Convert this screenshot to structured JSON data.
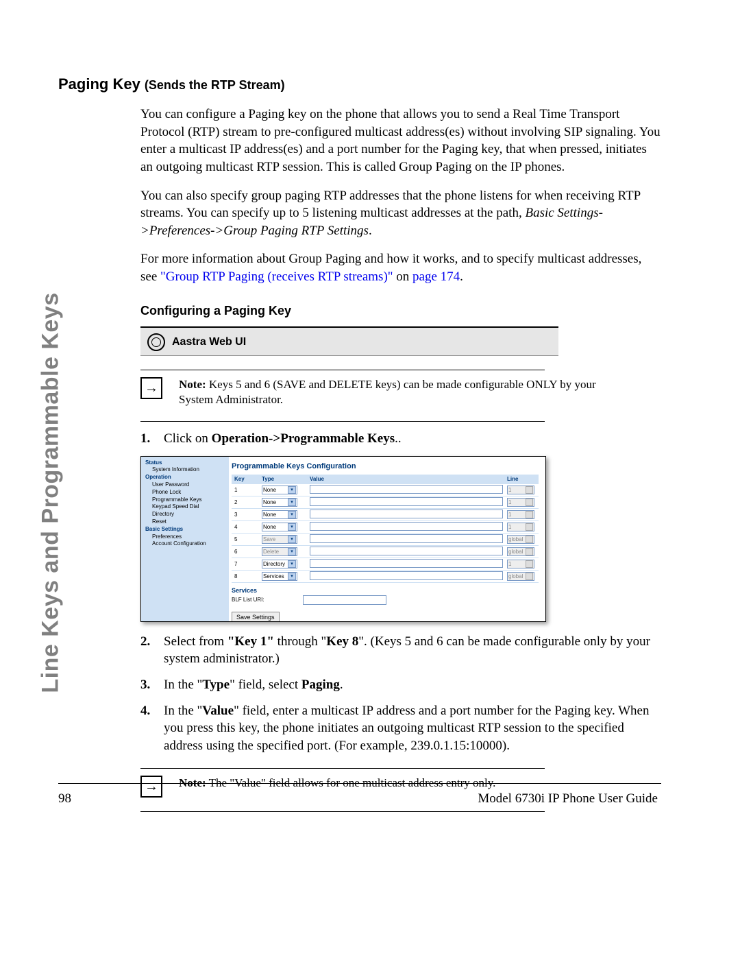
{
  "sidebar_label": "Line Keys and Programmable Keys",
  "h1_main": "Paging Key ",
  "h1_sub": "(Sends the RTP Stream)",
  "para1": "You can configure a Paging key on the phone that allows you to send a Real Time Transport Protocol (RTP) stream to pre-configured multicast address(es) without involving SIP signaling. You enter a multicast IP address(es) and a port number for the Paging key, that when pressed, initiates an outgoing multicast RTP session. This is called Group Paging on the IP phones.",
  "para2_a": "You can also specify group paging RTP addresses that the phone listens for when receiving RTP streams. You can specify up to 5 listening multicast addresses at the path, ",
  "para2_b": "Basic Settings->Preferences->Group Paging RTP Settings",
  "para2_c": ".",
  "para3_a": "For more information about Group Paging and how it works, and to specify multicast addresses, see ",
  "para3_link1": "\"Group RTP Paging (receives RTP streams)\"",
  "para3_b": " on ",
  "para3_link2": "page 174",
  "para3_c": ".",
  "h2": "Configuring a Paging Key",
  "ui_bar_title": "Aastra Web UI",
  "note1_label": "Note:",
  "note1_text": " Keys 5 and 6 (SAVE and DELETE keys) can be made configurable ONLY by your System Administrator.",
  "step1_num": "1.",
  "step1_a": "Click on ",
  "step1_b": "Operation->Programmable Keys",
  "step1_c": "..",
  "ss": {
    "nav": {
      "status": "Status",
      "sysinfo": "System Information",
      "operation": "Operation",
      "user_password": "User Password",
      "phone_lock": "Phone Lock",
      "prog_keys": "Programmable Keys",
      "keypad": "Keypad Speed Dial",
      "directory": "Directory",
      "reset": "Reset",
      "basic": "Basic Settings",
      "prefs": "Preferences",
      "acct": "Account Configuration"
    },
    "title": "Programmable Keys Configuration",
    "headers": {
      "key": "Key",
      "type": "Type",
      "value": "Value",
      "line": "Line"
    },
    "rows": [
      {
        "key": "1",
        "type": "None",
        "type_disabled": false,
        "line": "1"
      },
      {
        "key": "2",
        "type": "None",
        "type_disabled": false,
        "line": "1"
      },
      {
        "key": "3",
        "type": "None",
        "type_disabled": false,
        "line": "1"
      },
      {
        "key": "4",
        "type": "None",
        "type_disabled": false,
        "line": "1"
      },
      {
        "key": "5",
        "type": "Save",
        "type_disabled": true,
        "line": "global"
      },
      {
        "key": "6",
        "type": "Delete",
        "type_disabled": true,
        "line": "global"
      },
      {
        "key": "7",
        "type": "Directory",
        "type_disabled": false,
        "line": "1"
      },
      {
        "key": "8",
        "type": "Services",
        "type_disabled": false,
        "line": "global"
      }
    ],
    "services": "Services",
    "blf_label": "BLF List URI:",
    "save_btn": "Save Settings"
  },
  "step2_num": "2.",
  "step2_a": "Select from ",
  "step2_b": "\"Key 1\"",
  "step2_c": " through \"",
  "step2_d": "Key 8",
  "step2_e": "\". (Keys 5 and 6 can be made configurable only by your system administrator.)",
  "step3_num": "3.",
  "step3_a": "In the \"",
  "step3_b": "Type",
  "step3_c": "\" field, select ",
  "step3_d": "Paging",
  "step3_e": ".",
  "step4_num": "4.",
  "step4_a": "In the \"",
  "step4_b": "Value",
  "step4_c": "\" field, enter a multicast IP address and a port number for the Paging key. When you press this key, the phone initiates an outgoing multicast RTP session to the specified address using the specified port. (For example, 239.0.1.15:10000).",
  "note2_label": "Note:",
  "note2_text": " The \"Value\" field allows for one multicast address entry only.",
  "page_number": "98",
  "guide_name": "Model 6730i IP Phone User Guide"
}
